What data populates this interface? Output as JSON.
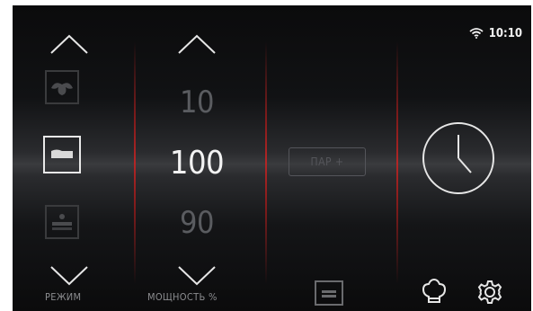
{
  "status": {
    "time": "10:10",
    "wifi_icon": "wifi-icon"
  },
  "mode_column": {
    "label": "РЕЖИМ",
    "items": [
      {
        "icon": "fan-icon",
        "state": "above"
      },
      {
        "icon": "heat-mode-icon",
        "state": "selected"
      },
      {
        "icon": "steam-mode-icon",
        "state": "below"
      }
    ],
    "up_icon": "chevron-up-icon",
    "down_icon": "chevron-down-icon"
  },
  "power_column": {
    "label": "МОЩНОСТЬ %",
    "values": [
      "10",
      "100",
      "90"
    ],
    "selected_value": "100",
    "up_icon": "chevron-up-icon",
    "down_icon": "chevron-down-icon"
  },
  "steam_button": {
    "label": "ПАР +"
  },
  "timer": {
    "icon": "clock-icon"
  },
  "bottom_bar": {
    "icons": [
      "tray-icon",
      "chef-hat-icon",
      "gear-icon"
    ]
  },
  "colors": {
    "accent_red": "#b42626",
    "text_active": "#f2f2f2",
    "text_dim": "#5a5c60"
  }
}
